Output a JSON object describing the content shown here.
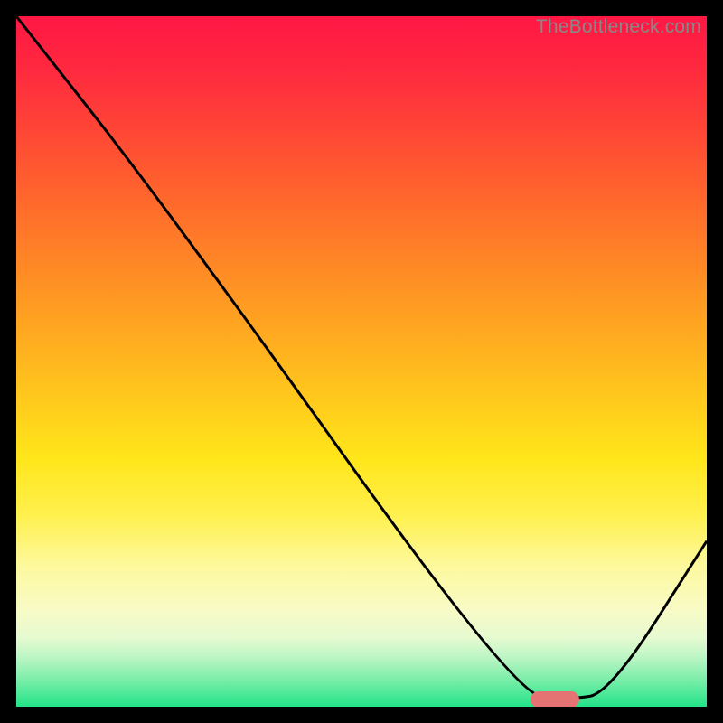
{
  "watermark": "TheBottleneck.com",
  "chart_data": {
    "type": "line",
    "title": "",
    "xlabel": "",
    "ylabel": "",
    "xlim": [
      0,
      100
    ],
    "ylim": [
      0,
      100
    ],
    "grid": false,
    "series": [
      {
        "name": "bottleneck-curve",
        "x": [
          0,
          22,
          72,
          80,
          86,
          100
        ],
        "y": [
          100,
          72,
          2,
          1,
          2,
          24
        ]
      }
    ],
    "optimal_marker": {
      "x_center": 78,
      "y": 1
    },
    "background": "red-yellow-green vertical gradient (red=high bottleneck at top, green=low at bottom)"
  },
  "colors": {
    "curve": "#000000",
    "marker": "#e57373",
    "frame": "#000000"
  }
}
